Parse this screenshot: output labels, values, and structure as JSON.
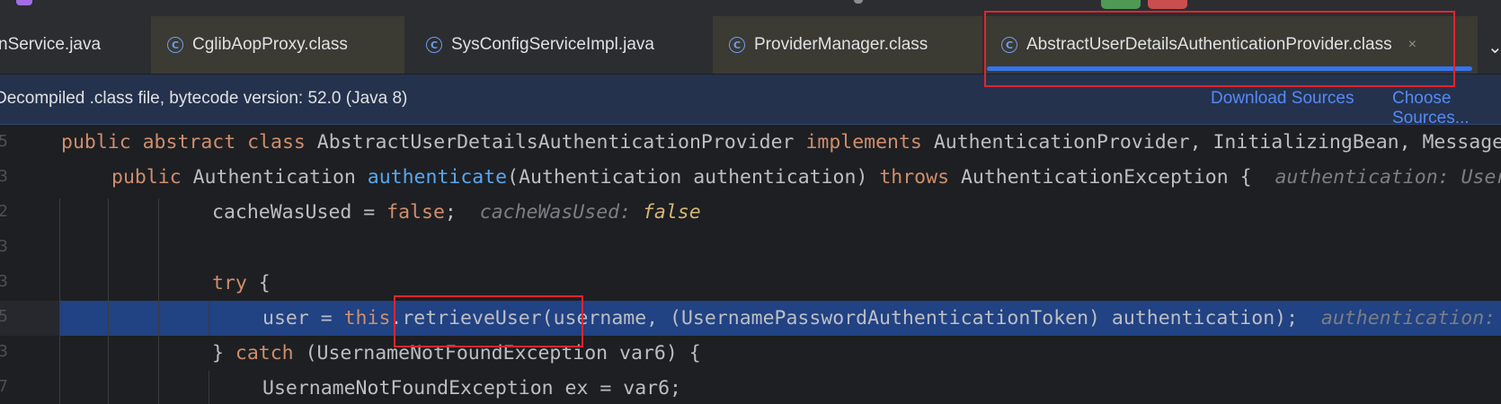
{
  "tabs": [
    {
      "label": "nService.java",
      "icon": "none"
    },
    {
      "label": "CglibAopProxy.class",
      "icon": "class-icon"
    },
    {
      "label": "SysConfigServiceImpl.java",
      "icon": "class-icon"
    },
    {
      "label": "ProviderManager.class",
      "icon": "class-icon"
    },
    {
      "label": "AbstractUserDetailsAuthenticationProvider.class",
      "icon": "class-icon",
      "active": true
    }
  ],
  "tab_close": "×",
  "tab_more": "⌄",
  "banner": {
    "text": "Decompiled .class file, bytecode version: 52.0 (Java 8)",
    "download_sources": "Download Sources",
    "choose_sources": "Choose Sources..."
  },
  "gutter": [
    "5",
    "3",
    "2",
    "3",
    "3",
    "5",
    "3",
    "7"
  ],
  "code": {
    "l1": {
      "kw1": "public abstract class ",
      "t1": "AbstractUserDetailsAuthenticationProvider ",
      "kw2": "implements ",
      "t2": "AuthenticationProvider, InitializingBean, MessageSourceAware {"
    },
    "l2": {
      "kw1": "public ",
      "t1": "Authentication ",
      "fn": "authenticate",
      "t2": "(Authentication authentication) ",
      "kw2": "throws ",
      "t3": "AuthenticationException {",
      "hint": "authentication: UsernamePasswordAuthenticationToken"
    },
    "l3": {
      "t1": "cacheWasUsed = ",
      "kw": "false",
      "t2": ";",
      "hint": "cacheWasUsed: ",
      "hint_val": "false"
    },
    "l5": {
      "kw": "try",
      "t1": " {"
    },
    "l6": {
      "t1": "user = ",
      "kw": "this",
      "t2": ".retrieveUser(username, (UsernamePasswordAuthenticationToken) authentication);",
      "hint": "authentication: UsernamePasswordAuthenticationToken"
    },
    "l7": {
      "t1": "} ",
      "kw": "catch",
      "t2": " (UsernameNotFoundException var6) {"
    },
    "l8": {
      "t1": "UsernameNotFoundException ex = var6;"
    }
  },
  "colors": {
    "keyword": "#cf8e6d",
    "function": "#56a8f5",
    "selection": "#214283",
    "accent": "#3574f0",
    "annotation_box": "#e0252e"
  }
}
